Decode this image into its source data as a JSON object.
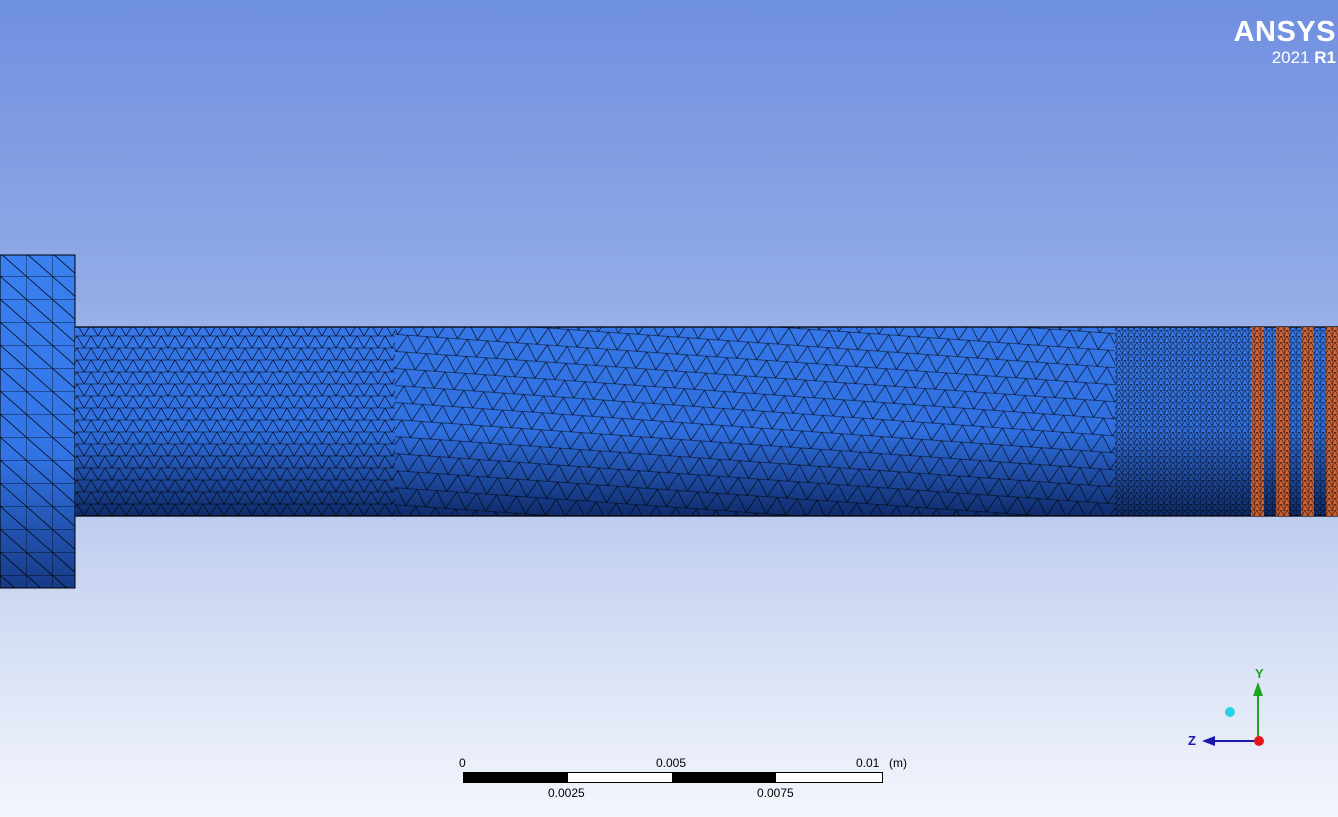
{
  "branding": {
    "product": "ANSYS",
    "version_year": "2021",
    "version_release": "R1"
  },
  "scale_bar": {
    "unit": "(m)",
    "top_labels": [
      "0",
      "0.005",
      "0.01"
    ],
    "bottom_labels": [
      "0.0025",
      "0.0075"
    ]
  },
  "triad": {
    "y_axis_label": "Y",
    "z_axis_label": "Z"
  },
  "colors": {
    "mesh_body": "#2f6fe0",
    "mesh_lines": "#000000",
    "highlight_bands": "#e0642a",
    "y_axis": "#1ea51e",
    "z_axis": "#1a1aa8",
    "x_axis_dot": "#e01818",
    "iso_ball": "#28d2e6"
  }
}
